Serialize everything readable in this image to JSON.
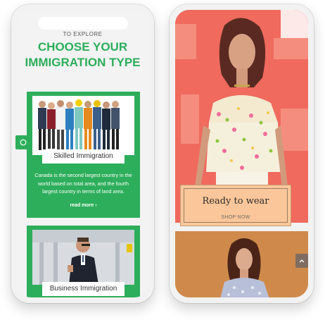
{
  "left_phone": {
    "eyebrow": "TO EXPLORE",
    "headline_line1": "CHOOSE YOUR",
    "headline_line2": "IMMIGRATION TYPE",
    "cards": [
      {
        "label": "Skilled Immigration",
        "description": "Canada is the second largest country in the world based on total area, and the fourth largest country in terms of land area.",
        "link": "read more ›"
      },
      {
        "label": "Business Immigration"
      }
    ],
    "whatsapp_icon": "whatsapp-icon",
    "accent_color": "#2dae5b"
  },
  "right_phone": {
    "promo_title": "Ready to wear",
    "promo_link": "SHOP NOW",
    "scroll_up_icon": "chevron-up-icon",
    "hero_color": "#f06a5e",
    "promo_color": "#fbc79a"
  }
}
